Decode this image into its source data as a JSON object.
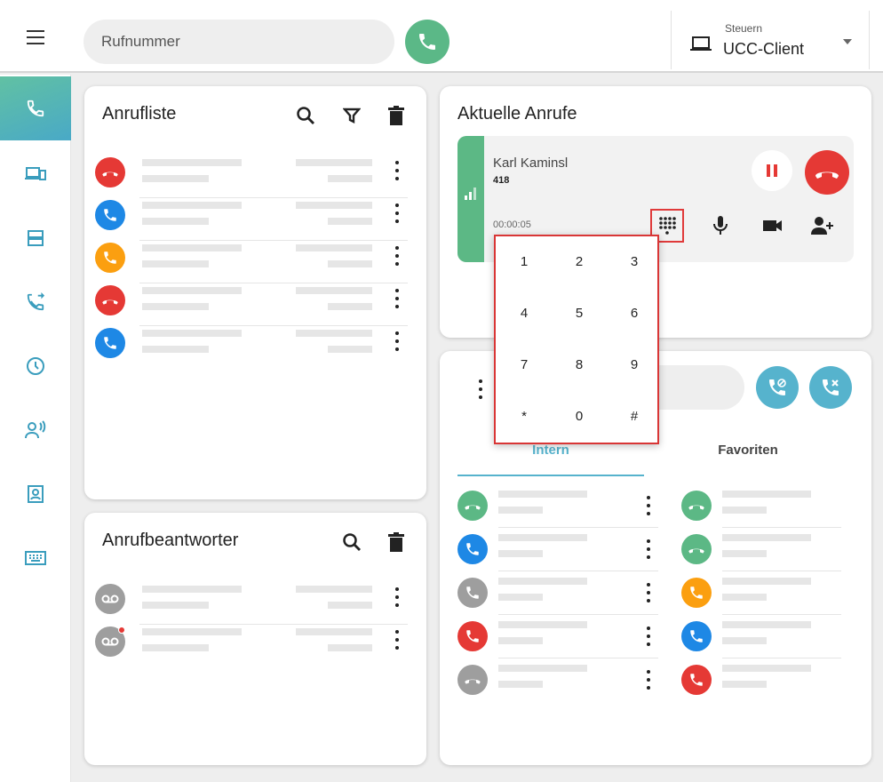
{
  "topbar": {
    "search_placeholder": "Rufnummer",
    "control_label": "Steuern",
    "control_value": "UCC-Client"
  },
  "nav": [
    "phone-icon",
    "devices-icon",
    "server-icon",
    "call-forward-icon",
    "clock-icon",
    "voice-icon",
    "contact-card-icon",
    "keyboard-icon"
  ],
  "call_list": {
    "title": "Anrufliste",
    "rows": [
      {
        "type": "missed",
        "color": "#e53935"
      },
      {
        "type": "incoming",
        "color": "#1e88e5"
      },
      {
        "type": "forwarded",
        "color": "#fb9f10"
      },
      {
        "type": "missed",
        "color": "#e53935"
      },
      {
        "type": "incoming",
        "color": "#1e88e5"
      }
    ]
  },
  "voicemail": {
    "title": "Anrufbeantworter",
    "rows": [
      {
        "unread": false,
        "color": "#9e9e9e"
      },
      {
        "unread": true,
        "color": "#9e9e9e"
      }
    ]
  },
  "active_calls": {
    "title": "Aktuelle Anrufe",
    "caller_name": "Karl Kaminsl",
    "caller_number": "418",
    "duration": "00:00:05"
  },
  "keypad": {
    "keys": [
      "1",
      "2",
      "3",
      "4",
      "5",
      "6",
      "7",
      "8",
      "9",
      "*",
      "0",
      "#"
    ]
  },
  "contacts": {
    "tabs": [
      "Intern",
      "Favoriten"
    ],
    "left_colors": [
      "#5cb885",
      "#1e88e5",
      "#9e9e9e",
      "#e53935",
      "#9e9e9e"
    ],
    "right_colors": [
      "#5cb885",
      "#5cb885",
      "#fb9f10",
      "#1e88e5",
      "#e53935"
    ]
  },
  "colors": {
    "accent_green": "#5cb885",
    "accent_blue": "#56b3cd",
    "danger": "#e53935"
  }
}
